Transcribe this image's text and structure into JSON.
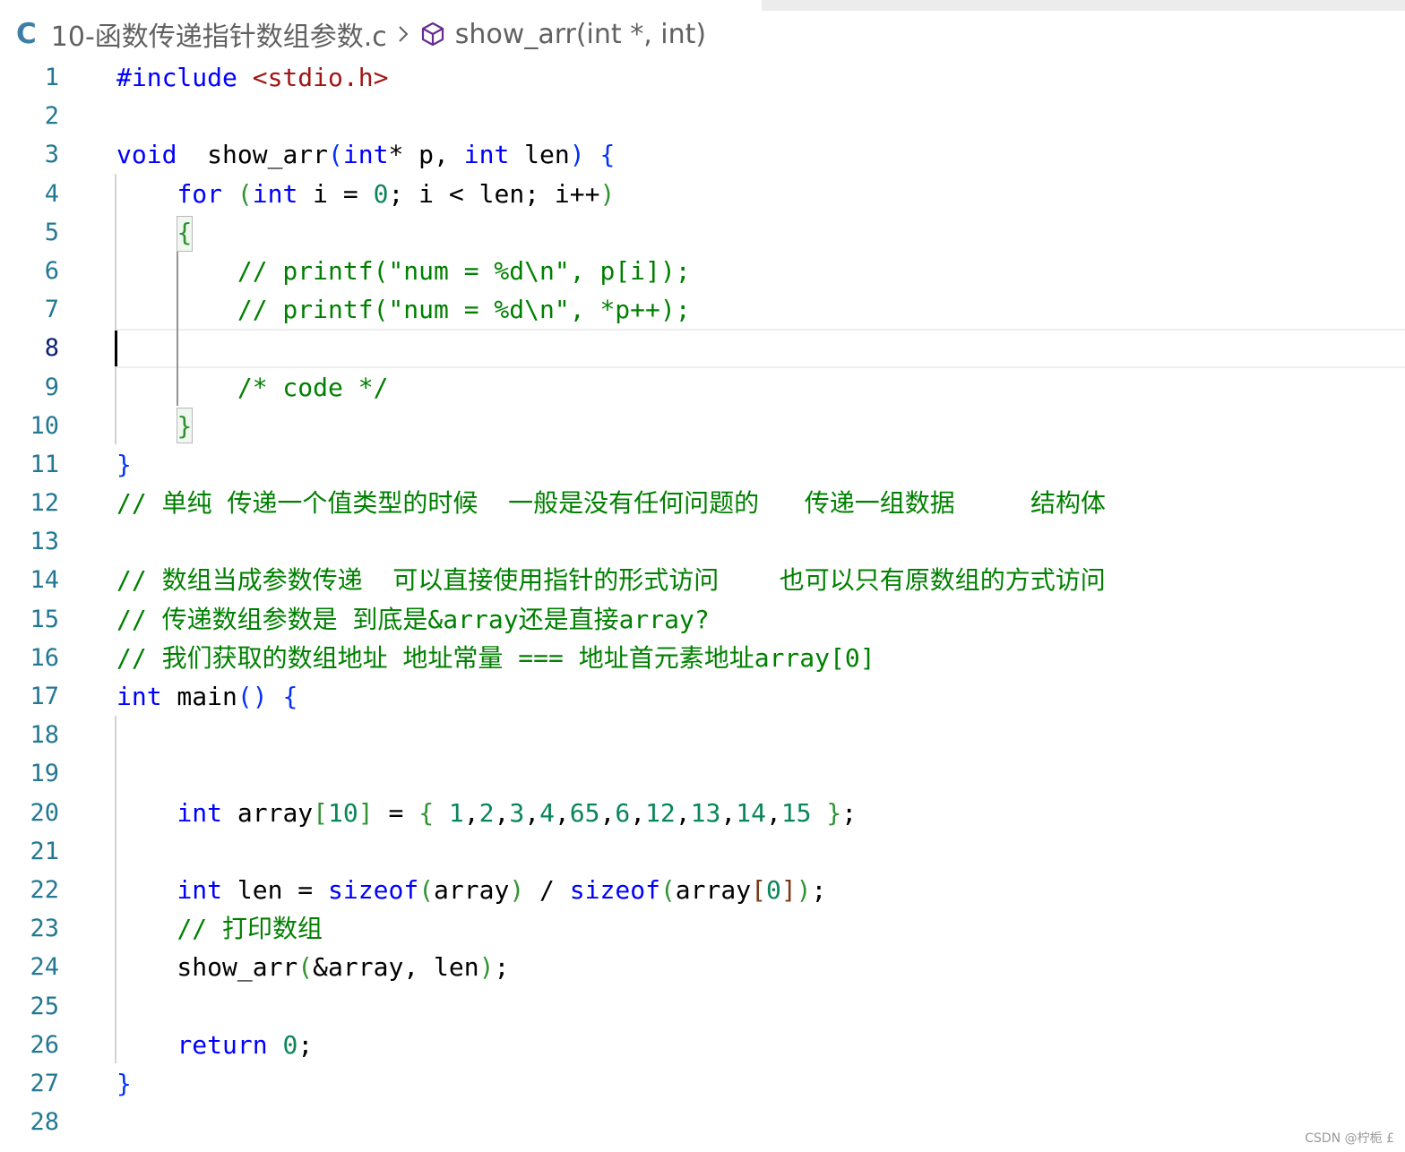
{
  "breadcrumb": {
    "file_icon": "C",
    "file_name": "10-函数传递指针数组参数.c",
    "separator_icon": "chevron-right-icon",
    "symbol_icon": "cube-icon",
    "symbol_name": "show_arr(int *, int)"
  },
  "editor": {
    "current_line": 8,
    "lines": [
      {
        "n": "1",
        "t": [
          [
            "pre",
            "#include "
          ],
          [
            "str",
            "<stdio.h>"
          ]
        ]
      },
      {
        "n": "2",
        "t": []
      },
      {
        "n": "3",
        "t": [
          [
            "kw",
            "void"
          ],
          [
            "",
            "  show_arr"
          ],
          [
            "b1",
            "("
          ],
          [
            "kw",
            "int"
          ],
          [
            "",
            "* p, "
          ],
          [
            "kw",
            "int"
          ],
          [
            "",
            " len"
          ],
          [
            "b1",
            ")"
          ],
          [
            "",
            " "
          ],
          [
            "b1",
            "{"
          ]
        ]
      },
      {
        "n": "4",
        "t": [
          [
            "",
            "    "
          ],
          [
            "kw",
            "for"
          ],
          [
            "",
            " "
          ],
          [
            "b2",
            "("
          ],
          [
            "kw",
            "int"
          ],
          [
            "",
            " i = "
          ],
          [
            "num",
            "0"
          ],
          [
            "",
            "; i < len; i++"
          ],
          [
            "b2",
            ")"
          ]
        ]
      },
      {
        "n": "5",
        "t": [
          [
            "",
            "    "
          ],
          [
            "b2",
            "{"
          ]
        ]
      },
      {
        "n": "6",
        "t": [
          [
            "",
            "        "
          ],
          [
            "cmt",
            "// printf(\"num = %d\\n\", p[i]);"
          ]
        ]
      },
      {
        "n": "7",
        "t": [
          [
            "",
            "        "
          ],
          [
            "cmt",
            "// printf(\"num = %d\\n\", *p++);"
          ]
        ]
      },
      {
        "n": "8",
        "t": []
      },
      {
        "n": "9",
        "t": [
          [
            "",
            "        "
          ],
          [
            "cmt",
            "/* code */"
          ]
        ]
      },
      {
        "n": "10",
        "t": [
          [
            "",
            "    "
          ],
          [
            "b2",
            "}"
          ]
        ]
      },
      {
        "n": "11",
        "t": [
          [
            "b1",
            "}"
          ]
        ]
      },
      {
        "n": "12",
        "t": [
          [
            "cmt",
            "// 单纯 传递一个值类型的时候  一般是没有任何问题的   传递一组数据     结构体"
          ]
        ]
      },
      {
        "n": "13",
        "t": []
      },
      {
        "n": "14",
        "t": [
          [
            "cmt",
            "// 数组当成参数传递  可以直接使用指针的形式访问    也可以只有原数组的方式访问"
          ]
        ]
      },
      {
        "n": "15",
        "t": [
          [
            "cmt",
            "// 传递数组参数是 到底是&array还是直接array?"
          ]
        ]
      },
      {
        "n": "16",
        "t": [
          [
            "cmt",
            "// 我们获取的数组地址 地址常量 === 地址首元素地址array[0]"
          ]
        ]
      },
      {
        "n": "17",
        "t": [
          [
            "kw",
            "int"
          ],
          [
            "",
            " main"
          ],
          [
            "b1",
            "()"
          ],
          [
            "",
            " "
          ],
          [
            "b1",
            "{"
          ]
        ]
      },
      {
        "n": "18",
        "t": []
      },
      {
        "n": "19",
        "t": []
      },
      {
        "n": "20",
        "t": [
          [
            "",
            "    "
          ],
          [
            "kw",
            "int"
          ],
          [
            "",
            " array"
          ],
          [
            "b2",
            "["
          ],
          [
            "num",
            "10"
          ],
          [
            "b2",
            "]"
          ],
          [
            "",
            " = "
          ],
          [
            "b2",
            "{"
          ],
          [
            "",
            " "
          ],
          [
            "num",
            "1"
          ],
          [
            ",",
            ","
          ],
          [
            "num",
            "2"
          ],
          [
            ",",
            ","
          ],
          [
            "num",
            "3"
          ],
          [
            ",",
            ","
          ],
          [
            "num",
            "4"
          ],
          [
            ",",
            ","
          ],
          [
            "num",
            "65"
          ],
          [
            ",",
            ","
          ],
          [
            "num",
            "6"
          ],
          [
            ",",
            ","
          ],
          [
            "num",
            "12"
          ],
          [
            ",",
            ","
          ],
          [
            "num",
            "13"
          ],
          [
            ",",
            ","
          ],
          [
            "num",
            "14"
          ],
          [
            ",",
            ","
          ],
          [
            "num",
            "15"
          ],
          [
            "",
            " "
          ],
          [
            "b2",
            "}"
          ],
          [
            "",
            ";"
          ]
        ]
      },
      {
        "n": "21",
        "t": []
      },
      {
        "n": "22",
        "t": [
          [
            "",
            "    "
          ],
          [
            "kw",
            "int"
          ],
          [
            "",
            " len = "
          ],
          [
            "kw",
            "sizeof"
          ],
          [
            "b2",
            "("
          ],
          [
            "",
            "array"
          ],
          [
            "b2",
            ")"
          ],
          [
            "",
            " / "
          ],
          [
            "kw",
            "sizeof"
          ],
          [
            "b2",
            "("
          ],
          [
            "",
            "array"
          ],
          [
            "b3",
            "["
          ],
          [
            "num",
            "0"
          ],
          [
            "b3",
            "]"
          ],
          [
            "b2",
            ")"
          ],
          [
            "",
            ";"
          ]
        ]
      },
      {
        "n": "23",
        "t": [
          [
            "",
            "    "
          ],
          [
            "cmt",
            "// 打印数组"
          ]
        ]
      },
      {
        "n": "24",
        "t": [
          [
            "",
            "    show_arr"
          ],
          [
            "b2",
            "("
          ],
          [
            "",
            "&array, len"
          ],
          [
            "b2",
            ")"
          ],
          [
            "",
            ";"
          ]
        ]
      },
      {
        "n": "25",
        "t": []
      },
      {
        "n": "26",
        "t": [
          [
            "",
            "    "
          ],
          [
            "kw",
            "return"
          ],
          [
            "",
            " "
          ],
          [
            "num",
            "0"
          ],
          [
            "",
            ";"
          ]
        ]
      },
      {
        "n": "27",
        "t": [
          [
            "b1",
            "}"
          ]
        ]
      },
      {
        "n": "28",
        "t": []
      }
    ]
  },
  "watermark": "CSDN @柠栀 £"
}
